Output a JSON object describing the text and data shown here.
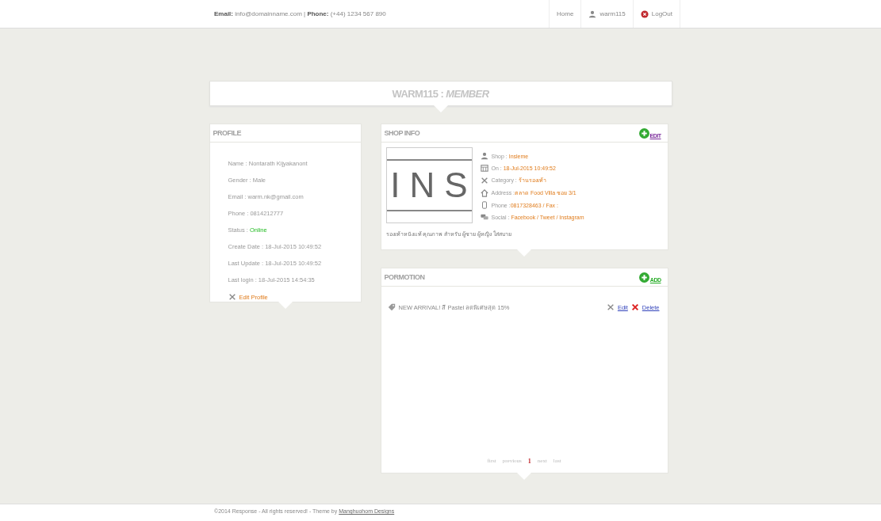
{
  "top_bar": {
    "contact": "**Email:** info@domainname.com | **Phone:** (+44) 1234 567 890",
    "nav": [
      {
        "label": "Home"
      },
      {
        "label": "warm115"
      },
      {
        "label": "LogOut"
      }
    ]
  },
  "page_title": "WARM115 : *MEMBER*",
  "profile": {
    "title": "PROFILE",
    "fields": [
      {
        "label": "Name : ",
        "value": "Nontarath Kijyakanont",
        "kind": "plain"
      },
      {
        "label": "Gender : ",
        "value": "Male",
        "kind": "plain"
      },
      {
        "label": "Email : ",
        "value": "warm.nk@gmail.com",
        "kind": "plain"
      },
      {
        "label": "Phone : ",
        "value": "0814212777",
        "kind": "plain"
      },
      {
        "label": "Status : ",
        "value": "Online",
        "kind": "status"
      },
      {
        "label": "Create Date : ",
        "value": "18-Jul-2015 10:49:52",
        "kind": "plain"
      },
      {
        "label": "Last Update : ",
        "value": "18-Jul-2015 10:49:52",
        "kind": "plain"
      },
      {
        "label": "Last login : ",
        "value": "18-Jul-2015 14:54:35",
        "kind": "plain"
      }
    ],
    "edit_link": "Edit Profile"
  },
  "shop_info": {
    "title": "SHOP INFO",
    "action": "EDIT",
    "logo_text": "INS",
    "details": [
      {
        "label": "Shop : ",
        "value": "Insleme"
      },
      {
        "label": "On : ",
        "value": "18-Jul-2015 10:49:52"
      },
      {
        "label": "Category : ",
        "value": "ร้านรองเท้า"
      },
      {
        "label": "Address :",
        "value": "ตลาด Food Villa ซอย 3/1"
      },
      {
        "label": "Phone :",
        "value": "0817328463 / Fax :"
      },
      {
        "label": "Social : ",
        "value": "Facebook / Tweet / Instagram"
      }
    ],
    "description": "รองเท้าหนังแท้ คุณภาพ สำหรับ ผู้ชาย ผู้หญิง ใส่สบาย"
  },
  "promotion": {
    "title": "PORMOTION",
    "action": "ADD",
    "items": [
      {
        "text": "NEW ARRIVAL! สี Pastel ลดพิเศษสุด 15%",
        "edit": "Edit",
        "delete": "Delete"
      }
    ],
    "pagination": [
      {
        "label": "first",
        "selected": false
      },
      {
        "label": "previous",
        "selected": false
      },
      {
        "label": "1",
        "selected": true
      },
      {
        "label": "next",
        "selected": false
      },
      {
        "label": "last",
        "selected": false
      }
    ]
  },
  "footer": {
    "text": "©2014 Response - All rights reserved! - Theme by ",
    "link": "Manghuohom Designs"
  }
}
